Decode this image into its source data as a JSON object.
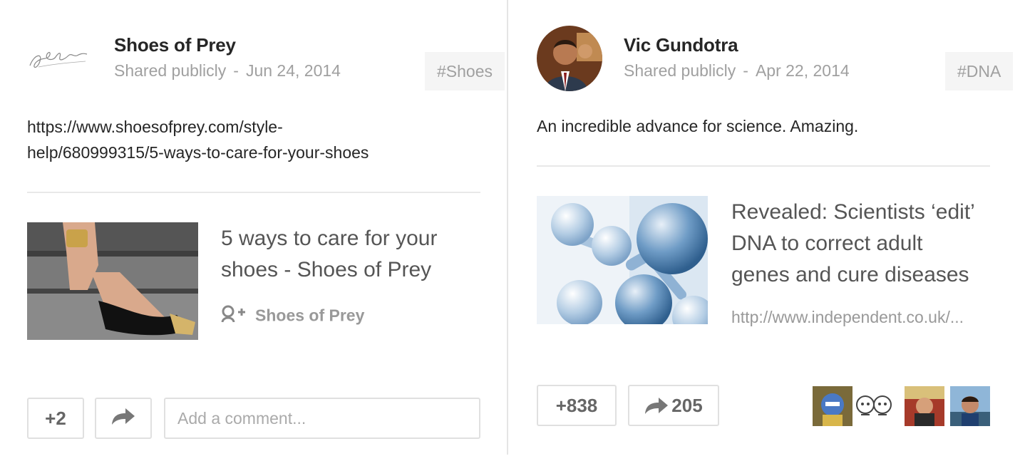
{
  "left_post": {
    "author": "Shoes of Prey",
    "visibility": "Shared publicly",
    "separator": "-",
    "date": "Jun 24, 2014",
    "hashtag": "#Shoes",
    "text_line1": "https://www.shoesofprey.com/style-",
    "text_line2": "help/680999315/5-ways-to-care-for-your-shoes",
    "link_title_line1": "5 ways to care for your",
    "link_title_line2": "shoes - Shoes of Prey",
    "link_source": "Shoes of Prey",
    "plus_count": "+2",
    "comment_placeholder": "Add a comment..."
  },
  "right_post": {
    "author": "Vic Gundotra",
    "visibility": "Shared publicly",
    "separator": "-",
    "date": "Apr 22, 2014",
    "hashtag": "#DNA",
    "text": "An incredible advance for science. Amazing.",
    "link_title_line1": "Revealed: Scientists ‘edit’",
    "link_title_line2": "DNA to correct adult",
    "link_title_line3": "genes and cure diseases",
    "link_url": "http://www.independent.co.uk/...",
    "plus_count": "+838",
    "share_count": "205"
  },
  "icons": {
    "share": "share-arrow-icon",
    "google_plus_page": "google-plus-page-icon"
  },
  "colors": {
    "divider": "#e5e5e5",
    "meta_text": "#a0a0a0",
    "hashtag_bg": "#f5f5f5"
  }
}
